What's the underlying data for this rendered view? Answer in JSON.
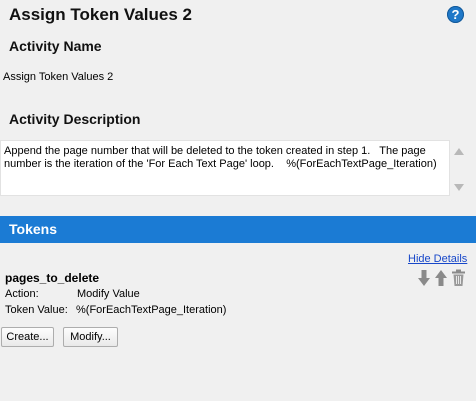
{
  "header": {
    "title": "Assign Token Values 2",
    "help_icon": "?"
  },
  "activity_name": {
    "heading": "Activity Name",
    "value": "Assign Token Values 2"
  },
  "activity_description": {
    "heading": "Activity Description",
    "text": "Append the page number that will be deleted to the token created in step 1.   The page number is the iteration of the 'For Each Text Page' loop.    %(ForEachTextPage_Iteration)"
  },
  "tokens": {
    "heading": "Tokens",
    "hide_details_label": "Hide Details",
    "items": [
      {
        "name": "pages_to_delete",
        "action_label": "Action:",
        "action_value": "Modify Value",
        "token_value_label": "Token Value:",
        "token_value": "%(ForEachTextPage_Iteration)"
      }
    ],
    "create_label": "Create...",
    "modify_label": "Modify..."
  },
  "colors": {
    "tokens_bar": "#1b7bd4",
    "help_icon": "#1f78c8",
    "link": "#1747c9"
  }
}
